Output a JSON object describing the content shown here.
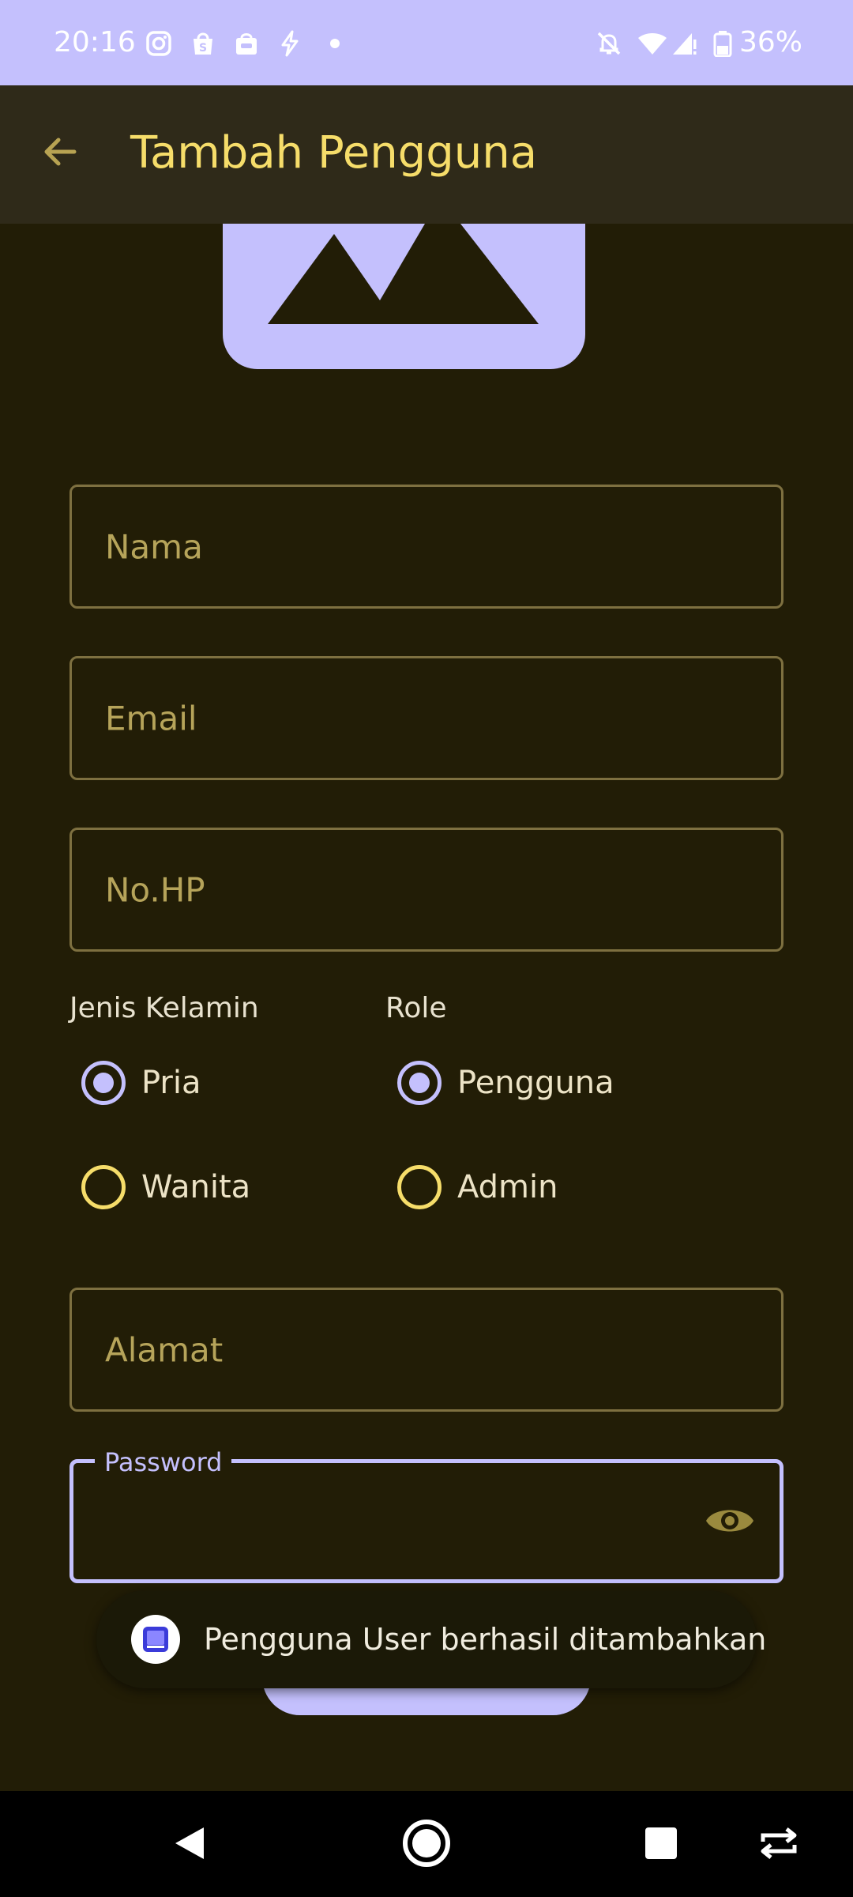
{
  "status_bar": {
    "time": "20:16",
    "battery_percent": "36%",
    "left_icons": [
      "instagram-icon",
      "shopee-icon",
      "shop-bag-icon",
      "bolt-icon",
      "dot-icon"
    ],
    "right_icons": [
      "bell-off-icon",
      "wifi-icon",
      "signal-icon",
      "battery-icon"
    ]
  },
  "app_bar": {
    "title": "Tambah Pengguna",
    "back_icon": "arrow-back-icon"
  },
  "form": {
    "nama_placeholder": "Nama",
    "email_placeholder": "Email",
    "nohp_placeholder": "No.HP",
    "alamat_placeholder": "Alamat",
    "password_label": "Password",
    "password_value": "",
    "gender": {
      "label": "Jenis Kelamin",
      "options": [
        "Pria",
        "Wanita"
      ],
      "selected": "Pria"
    },
    "role": {
      "label": "Role",
      "options": [
        "Pengguna",
        "Admin"
      ],
      "selected": "Pengguna"
    }
  },
  "toast": {
    "message": "Pengguna User berhasil ditambahkan"
  },
  "colors": {
    "background": "#221d06",
    "accent_lavender": "#c4c0fd",
    "accent_yellow": "#f6dd6a",
    "field_border": "#7e7040",
    "placeholder": "#b6a45a"
  },
  "nav_bar": {
    "buttons": [
      "back-triangle-icon",
      "home-circle-icon",
      "recents-square-icon",
      "rotate-icon"
    ]
  }
}
